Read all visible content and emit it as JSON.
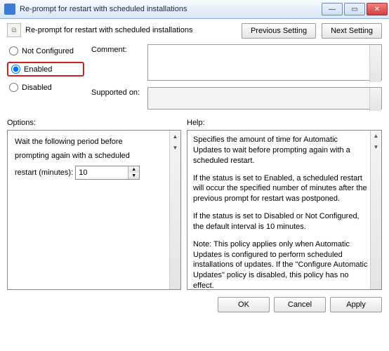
{
  "window": {
    "title": "Re-prompt for restart with scheduled installations"
  },
  "header": {
    "policy_name": "Re-prompt for restart with scheduled installations",
    "previous": "Previous Setting",
    "next": "Next Setting"
  },
  "state": {
    "not_configured": "Not Configured",
    "enabled": "Enabled",
    "disabled": "Disabled",
    "selected": "enabled"
  },
  "fields": {
    "comment_label": "Comment:",
    "comment_value": "",
    "supported_label": "Supported on:",
    "supported_value": ""
  },
  "sections": {
    "options_label": "Options:",
    "help_label": "Help:"
  },
  "options": {
    "line1": "Wait the following period before",
    "line2": "prompting again with a scheduled",
    "restart_label": "restart (minutes):",
    "restart_value": "10"
  },
  "help": {
    "p1": "Specifies the amount of time for Automatic Updates to wait before prompting again with a scheduled restart.",
    "p2": "If the status is set to Enabled, a scheduled restart will occur the specified number of minutes after the previous prompt for restart was postponed.",
    "p3": "If the status is set to Disabled or Not Configured, the default interval is 10 minutes.",
    "p4": "Note: This policy applies only when Automatic Updates is configured to perform scheduled installations of updates. If the \"Configure Automatic Updates\" policy is disabled, this policy has no effect."
  },
  "footer": {
    "ok": "OK",
    "cancel": "Cancel",
    "apply": "Apply"
  }
}
